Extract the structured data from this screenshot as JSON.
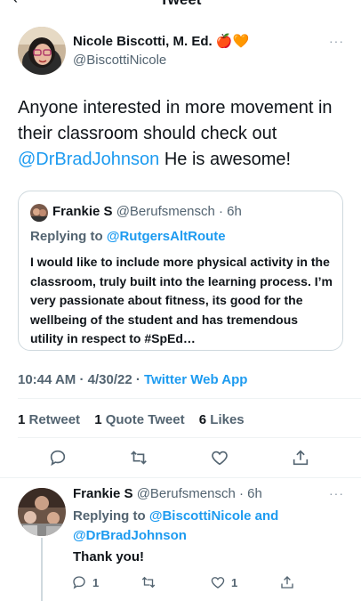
{
  "header": {
    "title": "Tweet",
    "back_icon": "back-arrow-icon"
  },
  "tweet": {
    "author_name": "Nicole Biscotti, M. Ed.",
    "author_emojis": "🍎🧡",
    "handle": "@BiscottiNicole",
    "text_part1": "Anyone interested in more movement in their classroom should check out ",
    "text_mention": "@DrBradJohnson",
    "text_part2": " He is awesome!",
    "quote": {
      "author_name": "Frankie S",
      "handle": "@Berufsmensch",
      "time": "· 6h",
      "replying_prefix": "Replying to ",
      "replying_to": "@RutgersAltRoute",
      "text": "I would like to include more physical activity in the classroom, truly built into the learning process.  I’m very passionate about fitness, its good for the wellbeing of the student and has tremendous utility in respect to #SpEd…"
    },
    "time": "10:44 AM · 4/30/22 · ",
    "source": "Twitter Web App",
    "stats": {
      "retweets_count": "1",
      "retweets_label": " Retweet",
      "quotes_count": "1",
      "quotes_label": " Quote Tweet",
      "likes_count": "6",
      "likes_label": " Likes"
    }
  },
  "reply": {
    "author_name": "Frankie S",
    "handle": "@Berufsmensch",
    "time": "· 6h",
    "replying_prefix": "Replying to ",
    "replying_to_1": "@BiscottiNicole",
    "replying_and": " and",
    "replying_to_2": "@DrBradJohnson",
    "text": "Thank you!",
    "reply_count": "1",
    "like_count": "1"
  },
  "colors": {
    "accent": "#1d9bf0",
    "text": "#0f1419",
    "secondary": "#536471",
    "border": "#cfd9de"
  }
}
